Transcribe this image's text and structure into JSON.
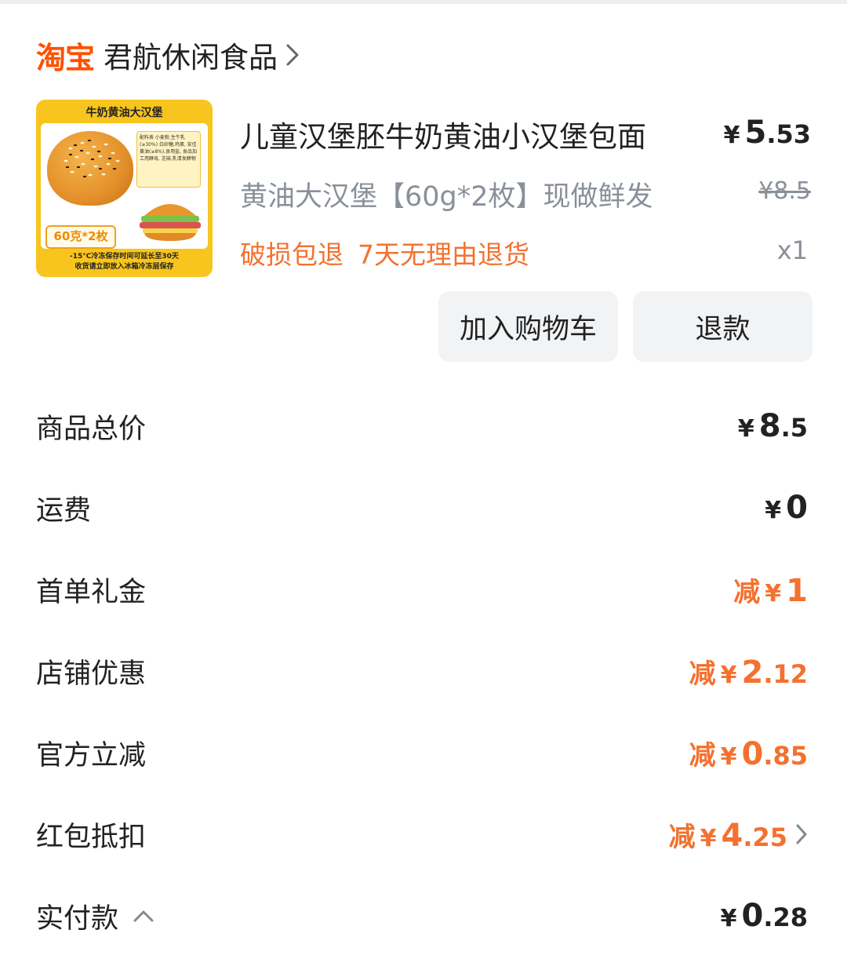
{
  "shop": {
    "logo": "淘宝",
    "name": "君航休闲食品"
  },
  "product": {
    "image_text": {
      "title": "牛奶黄油大汉堡",
      "badge": "60克*2枚",
      "note": "配料表 小麦粉,生牛乳(≥30%) 白砂糖,鸡蛋, 安佳黄油(≥8%),食用盐, 食品加工用酵母, 芝麻,乳清发酵物",
      "foot1": "-15°C冷冻保存时间可延长至30天",
      "foot2": "收货请立即放入冰箱冷冻层保存"
    },
    "title": "儿童汉堡胚牛奶黄油小汉堡包面",
    "price_yen": "¥",
    "price_int": "5",
    "price_dec": ".53",
    "spec": "黄油大汉堡【60g*2枚】现做鲜发",
    "original_price": "¥8.5",
    "tags": [
      "破损包退",
      "7天无理由退货"
    ],
    "quantity": "x1"
  },
  "buttons": {
    "add_to_cart": "加入购物车",
    "refund": "退款"
  },
  "summary": {
    "total": {
      "label": "商品总价",
      "yen": "¥",
      "int": "8",
      "dec": ".5"
    },
    "shipping": {
      "label": "运费",
      "yen": "¥",
      "int": "0",
      "dec": ""
    },
    "first_order": {
      "label": "首单礼金",
      "prefix": "减",
      "yen": "¥",
      "int": "1",
      "dec": ""
    },
    "store_discount": {
      "label": "店铺优惠",
      "prefix": "减",
      "yen": "¥",
      "int": "2",
      "dec": ".12"
    },
    "official": {
      "label": "官方立减",
      "prefix": "减",
      "yen": "¥",
      "int": "0",
      "dec": ".85"
    },
    "red_packet": {
      "label": "红包抵扣",
      "prefix": "减",
      "yen": "¥",
      "int": "4",
      "dec": ".25"
    },
    "paid": {
      "label": "实付款",
      "yen": "¥",
      "int": "0",
      "dec": ".28"
    }
  },
  "colors": {
    "accent": "#f4712f",
    "logo": "#ff5000",
    "muted": "#8a9099",
    "button_bg": "#f1f3f5"
  }
}
